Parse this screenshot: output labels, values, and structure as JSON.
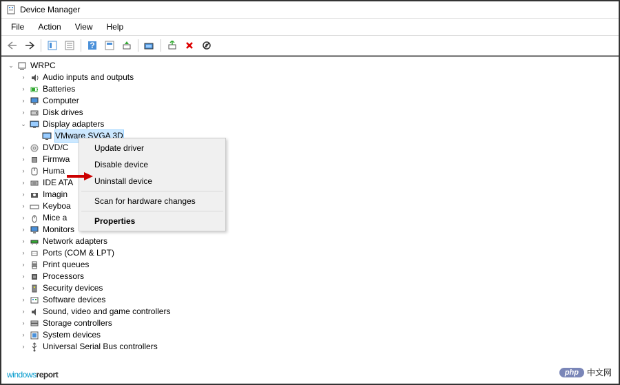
{
  "window": {
    "title": "Device Manager"
  },
  "menu": {
    "file": "File",
    "action": "Action",
    "view": "View",
    "help": "Help"
  },
  "tree": {
    "root": "WRPC",
    "nodes": [
      {
        "label": "Audio inputs and outputs",
        "icon": "audio"
      },
      {
        "label": "Batteries",
        "icon": "battery"
      },
      {
        "label": "Computer",
        "icon": "computer"
      },
      {
        "label": "Disk drives",
        "icon": "disk"
      },
      {
        "label": "Display adapters",
        "icon": "display",
        "expanded": true
      },
      {
        "label": "VMware SVGA 3D",
        "icon": "display",
        "child": true,
        "selected": true
      },
      {
        "label": "DVD/C",
        "icon": "dvd"
      },
      {
        "label": "Firmwa",
        "icon": "firmware"
      },
      {
        "label": "Huma",
        "icon": "hid"
      },
      {
        "label": "IDE ATA",
        "icon": "ide"
      },
      {
        "label": "Imagin",
        "icon": "imaging"
      },
      {
        "label": "Keyboa",
        "icon": "keyboard"
      },
      {
        "label": "Mice a",
        "icon": "mouse"
      },
      {
        "label": "Monitors",
        "icon": "monitor"
      },
      {
        "label": "Network adapters",
        "icon": "network"
      },
      {
        "label": "Ports (COM & LPT)",
        "icon": "port"
      },
      {
        "label": "Print queues",
        "icon": "printer"
      },
      {
        "label": "Processors",
        "icon": "cpu"
      },
      {
        "label": "Security devices",
        "icon": "security"
      },
      {
        "label": "Software devices",
        "icon": "software"
      },
      {
        "label": "Sound, video and game controllers",
        "icon": "sound"
      },
      {
        "label": "Storage controllers",
        "icon": "storage"
      },
      {
        "label": "System devices",
        "icon": "system"
      },
      {
        "label": "Universal Serial Bus controllers",
        "icon": "usb"
      }
    ]
  },
  "context": {
    "update": "Update driver",
    "disable": "Disable device",
    "uninstall": "Uninstall device",
    "scan": "Scan for hardware changes",
    "properties": "Properties"
  },
  "watermarks": {
    "left1": "windows",
    "left2": "report",
    "badge": "php",
    "right": "中文网"
  }
}
